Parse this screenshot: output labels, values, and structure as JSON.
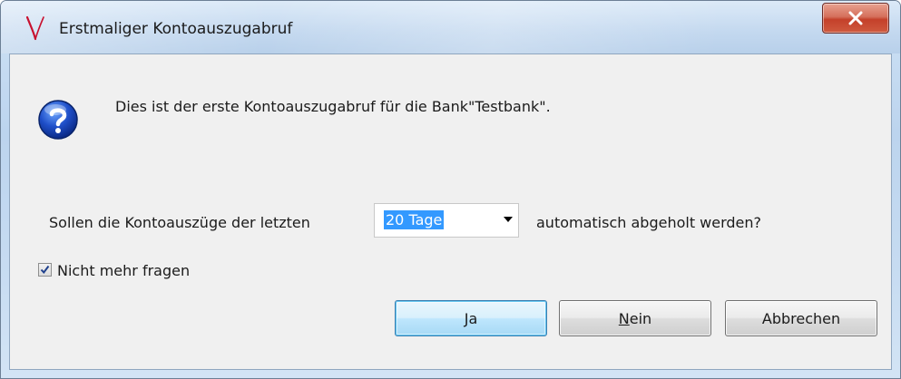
{
  "window": {
    "title": "Erstmaliger Kontoauszugabruf",
    "icon": "app-logo-icon",
    "close_icon": "close-icon"
  },
  "dialog": {
    "icon": "question-icon",
    "message": "Dies ist der erste Kontoauszugabruf für die Bank\"Testbank\".",
    "label_before": "Sollen die Kontoauszüge der letzten",
    "label_after": "automatisch abgeholt werden?",
    "period_select": {
      "value": "20 Tage"
    },
    "checkbox": {
      "label": "Nicht mehr fragen",
      "checked": true
    },
    "buttons": {
      "yes": "Ja",
      "no": "Nein",
      "cancel": "Abbrechen"
    }
  },
  "colors": {
    "selection": "#3399ff",
    "close_button": "#c4402a",
    "default_button_border": "#3c7fb1"
  }
}
